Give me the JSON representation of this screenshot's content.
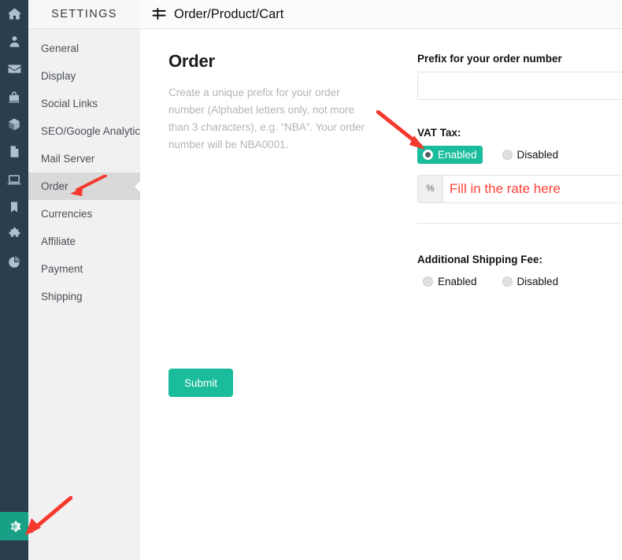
{
  "rail": {
    "items": [
      {
        "icon": "home-icon"
      },
      {
        "icon": "user-icon"
      },
      {
        "icon": "mail-icon"
      },
      {
        "icon": "bag-icon"
      },
      {
        "icon": "box-icon"
      },
      {
        "icon": "file-icon"
      },
      {
        "icon": "laptop-icon"
      },
      {
        "icon": "bookmark-icon"
      },
      {
        "icon": "puzzle-icon"
      },
      {
        "icon": "pie-chart-icon"
      }
    ],
    "gear": {
      "icon": "gear-icon",
      "active_color": "#16a085"
    },
    "background": "#2b3e50"
  },
  "sidebar": {
    "title": "SETTINGS",
    "active_index": 5,
    "items": [
      {
        "label": "General"
      },
      {
        "label": "Display"
      },
      {
        "label": "Social Links"
      },
      {
        "label": "SEO/Google Analytic"
      },
      {
        "label": "Mail Server"
      },
      {
        "label": "Order"
      },
      {
        "label": "Currencies"
      },
      {
        "label": "Affiliate"
      },
      {
        "label": "Payment"
      },
      {
        "label": "Shipping"
      }
    ]
  },
  "topbar": {
    "icon": "sliders-icon",
    "title": "Order/Product/Cart"
  },
  "main": {
    "heading": "Order",
    "description": "Create a unique prefix for your order number (Alphabet letters only, not more than 3 characters), e.g. “NBA”. Your order number will be NBA0001.",
    "submit_label": "Submit"
  },
  "form": {
    "prefix": {
      "label": "Prefix for your order number",
      "value": "",
      "placeholder": ""
    },
    "vat_tax": {
      "label": "VAT Tax:",
      "enabled_label": "Enabled",
      "disabled_label": "Disabled",
      "selected": "Enabled"
    },
    "rate": {
      "addon": "%",
      "value": "",
      "placeholder": "Fill in the rate here"
    },
    "shipping_fee": {
      "label": "Additional Shipping Fee:",
      "enabled_label": "Enabled",
      "disabled_label": "Disabled",
      "selected": ""
    }
  },
  "annotations": {
    "color": "#f5392e",
    "arrows": [
      {
        "name": "arrow-to-order-menu",
        "target": "Order"
      },
      {
        "name": "arrow-to-vat-enabled",
        "target": "Enabled"
      },
      {
        "name": "arrow-to-gear-icon",
        "target": "gear-icon"
      }
    ]
  },
  "colors": {
    "accent_teal": "#1abc9c",
    "rail_dark": "#2b3e50",
    "annotation_red": "#f5392e",
    "muted_text": "#b5b5b5"
  }
}
